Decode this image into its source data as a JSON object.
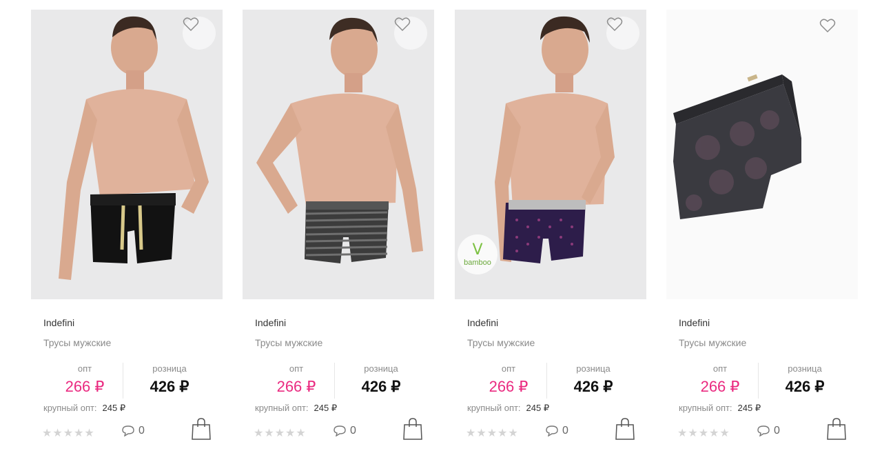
{
  "products": [
    {
      "brand": "Indefini",
      "title": "Трусы мужские",
      "opt_label": "опт",
      "opt_price": "266 ₽",
      "retail_label": "розница",
      "retail_price": "426 ₽",
      "bulk_label": "крупный опт:",
      "bulk_price": "245 ₽",
      "comments": "0",
      "rating": 0,
      "badge": null
    },
    {
      "brand": "Indefini",
      "title": "Трусы мужские",
      "opt_label": "опт",
      "opt_price": "266 ₽",
      "retail_label": "розница",
      "retail_price": "426 ₽",
      "bulk_label": "крупный опт:",
      "bulk_price": "245 ₽",
      "comments": "0",
      "rating": 0,
      "badge": null
    },
    {
      "brand": "Indefini",
      "title": "Трусы мужские",
      "opt_label": "опт",
      "opt_price": "266 ₽",
      "retail_label": "розница",
      "retail_price": "426 ₽",
      "bulk_label": "крупный опт:",
      "bulk_price": "245 ₽",
      "comments": "0",
      "rating": 0,
      "badge": "bamboo"
    },
    {
      "brand": "Indefini",
      "title": "Трусы мужские",
      "opt_label": "опт",
      "opt_price": "266 ₽",
      "retail_label": "розница",
      "retail_price": "426 ₽",
      "bulk_label": "крупный опт:",
      "bulk_price": "245 ₽",
      "comments": "0",
      "rating": 0,
      "badge": null
    }
  ],
  "icons": {
    "favorite": "heart-outline-icon",
    "comment": "speech-bubble-icon",
    "cart": "shopping-bag-icon",
    "star": "star-icon",
    "badge": "bamboo-leaf-icon"
  },
  "colors": {
    "opt_price": "#ea2a80",
    "retail_price": "#111111",
    "muted": "#8a8a8a",
    "star_empty": "#d4d4d4",
    "bamboo": "#7cc142"
  }
}
